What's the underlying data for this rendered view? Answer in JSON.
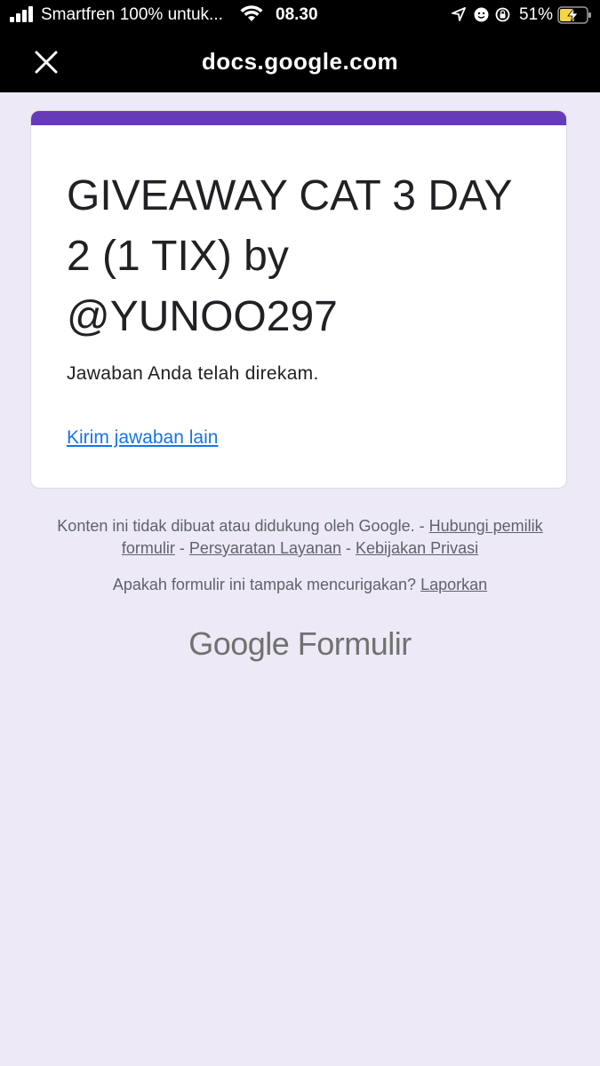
{
  "status_bar": {
    "carrier": "Smartfren 100% untuk...",
    "time": "08.30",
    "battery_percent": "51%"
  },
  "browser": {
    "domain": "docs.google.com",
    "close_icon": "close-icon"
  },
  "form": {
    "accent_color": "#673ab7",
    "title": "GIVEAWAY CAT 3 DAY 2 (1 TIX) by @YUNOO297",
    "confirmation_message": "Jawaban Anda telah direkam.",
    "submit_another_link": "Kirim jawaban lain"
  },
  "footer": {
    "disclaimer": "Konten ini tidak dibuat atau didukung oleh Google.",
    "sep1": " - ",
    "contact_owner": "Hubungi pemilik formulir",
    "sep2": " - ",
    "terms": "Persyaratan Layanan",
    "sep3": " - ",
    "privacy": "Kebijakan Privasi",
    "suspicious_question": "Apakah formulir ini tampak mencurigakan?",
    "report": "Laporkan",
    "brand_google": "Google",
    "brand_product": "Formulir"
  }
}
